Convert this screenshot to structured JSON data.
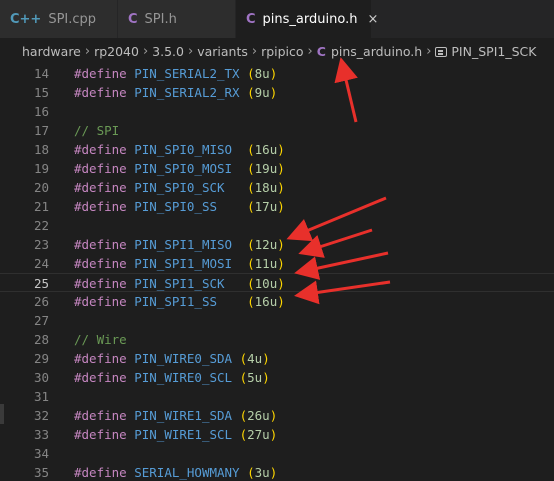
{
  "tabs": [
    {
      "label": "SPI.cpp",
      "icon": "C++",
      "active": false
    },
    {
      "label": "SPI.h",
      "icon": "C",
      "active": false
    },
    {
      "label": "pins_arduino.h",
      "icon": "C",
      "active": true,
      "close": "×"
    }
  ],
  "breadcrumb": {
    "items": [
      "hardware",
      "rp2040",
      "3.5.0",
      "variants",
      "rpipico"
    ],
    "file_icon": "C",
    "file": "pins_arduino.h",
    "symbol": "PIN_SPI1_SCK"
  },
  "editor": {
    "current_line": "25",
    "lines": [
      {
        "n": "14",
        "kw": "#define",
        "name": "PIN_SERIAL2_TX",
        "pad": " ",
        "val": "8u"
      },
      {
        "n": "15",
        "kw": "#define",
        "name": "PIN_SERIAL2_RX",
        "pad": " ",
        "val": "9u"
      },
      {
        "n": "16"
      },
      {
        "n": "17",
        "comment": "// SPI"
      },
      {
        "n": "18",
        "kw": "#define",
        "name": "PIN_SPI0_MISO",
        "pad": "  ",
        "val": "16u"
      },
      {
        "n": "19",
        "kw": "#define",
        "name": "PIN_SPI0_MOSI",
        "pad": "  ",
        "val": "19u"
      },
      {
        "n": "20",
        "kw": "#define",
        "name": "PIN_SPI0_SCK",
        "pad": "   ",
        "val": "18u"
      },
      {
        "n": "21",
        "kw": "#define",
        "name": "PIN_SPI0_SS",
        "pad": "    ",
        "val": "17u"
      },
      {
        "n": "22"
      },
      {
        "n": "23",
        "kw": "#define",
        "name": "PIN_SPI1_MISO",
        "pad": "  ",
        "val": "12u"
      },
      {
        "n": "24",
        "kw": "#define",
        "name": "PIN_SPI1_MOSI",
        "pad": "  ",
        "val": "11u"
      },
      {
        "n": "25",
        "kw": "#define",
        "name": "PIN_SPI1_SCK",
        "pad": "   ",
        "val": "10u"
      },
      {
        "n": "26",
        "kw": "#define",
        "name": "PIN_SPI1_SS",
        "pad": "    ",
        "val": "16u"
      },
      {
        "n": "27"
      },
      {
        "n": "28",
        "comment": "// Wire"
      },
      {
        "n": "29",
        "kw": "#define",
        "name": "PIN_WIRE0_SDA",
        "pad": " ",
        "val": "4u"
      },
      {
        "n": "30",
        "kw": "#define",
        "name": "PIN_WIRE0_SCL",
        "pad": " ",
        "val": "5u"
      },
      {
        "n": "31"
      },
      {
        "n": "32",
        "kw": "#define",
        "name": "PIN_WIRE1_SDA",
        "pad": " ",
        "val": "26u"
      },
      {
        "n": "33",
        "kw": "#define",
        "name": "PIN_WIRE1_SCL",
        "pad": " ",
        "val": "27u"
      },
      {
        "n": "34"
      },
      {
        "n": "35",
        "kw": "#define",
        "name": "SERIAL_HOWMANY",
        "pad": " ",
        "val": "3u"
      }
    ]
  },
  "colors": {
    "arrow": "#e8302b",
    "keyword": "#c586c0",
    "macro": "#569cd6",
    "number": "#b5cea8",
    "bracket": "#ffd700",
    "comment": "#6a9955"
  }
}
